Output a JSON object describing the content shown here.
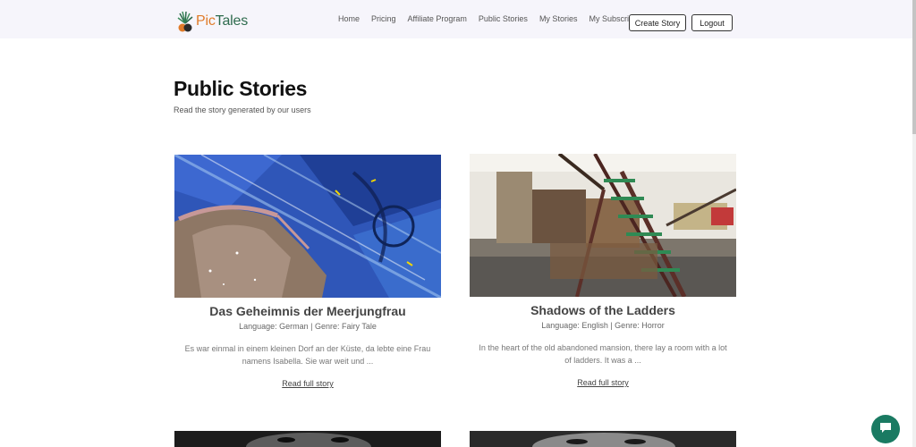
{
  "brand": {
    "name_part1": "Pic",
    "name_part2": "Tales"
  },
  "nav": {
    "links": [
      "Home",
      "Pricing",
      "Affiliate Program",
      "Public Stories",
      "My Stories",
      "My Subscriptions"
    ],
    "create_label": "Create Story",
    "logout_label": "Logout"
  },
  "page": {
    "title": "Public Stories",
    "subtitle": "Read the story generated by our users"
  },
  "stories": [
    {
      "title": "Das Geheimnis der Meerjungfrau",
      "meta": "Language: German | Genre: Fairy Tale",
      "excerpt": "Es war einmal in einem kleinen Dorf an der Küste, da lebte eine Frau namens Isabella. Sie war weit und ...",
      "link": "Read full story"
    },
    {
      "title": "Shadows of the Ladders",
      "meta": "Language: English | Genre: Horror",
      "excerpt": "In the heart of the old abandoned mansion, there lay a room with a lot of ladders. It was a ...",
      "link": "Read full story"
    }
  ],
  "colors": {
    "accent": "#1a7a62",
    "nav_bg": "#f6f5fb",
    "logo_orange": "#e07b2a",
    "logo_green": "#2e6b4e"
  },
  "icons": {
    "chat": "chat-bubble-icon",
    "logo": "palm-logo-icon"
  }
}
